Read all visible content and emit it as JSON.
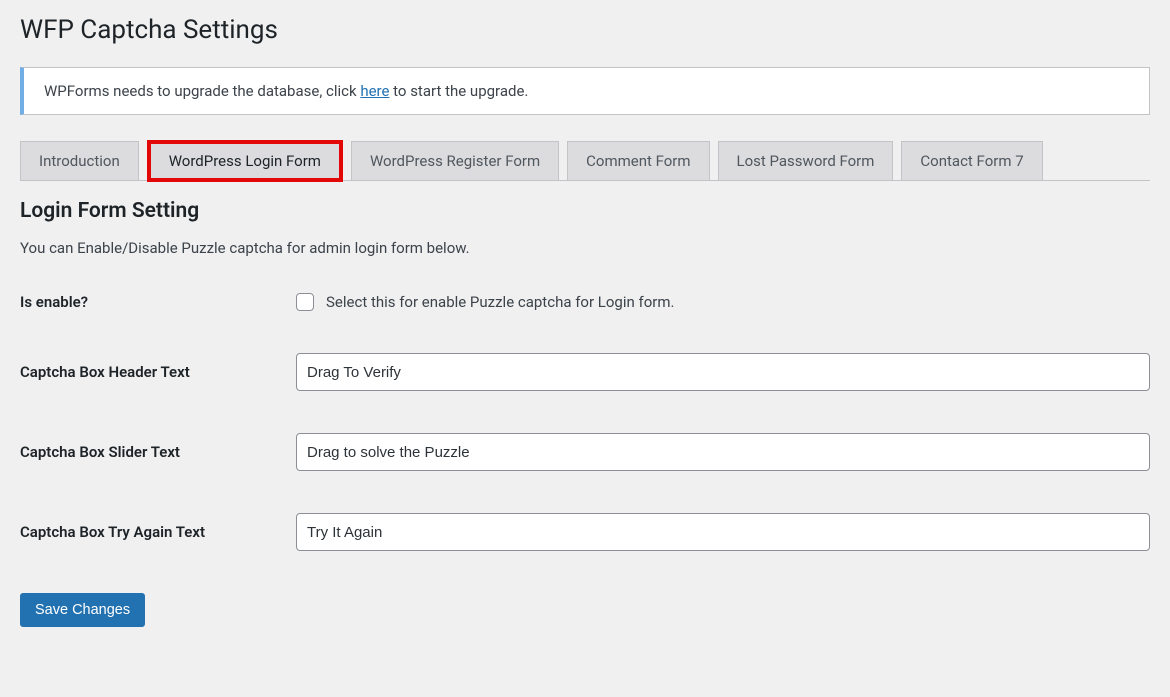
{
  "page": {
    "title": "WFP Captcha Settings"
  },
  "notice": {
    "text_before": "WPForms needs to upgrade the database, click ",
    "link_text": "here",
    "text_after": " to start the upgrade."
  },
  "tabs": [
    {
      "label": "Introduction",
      "active": false
    },
    {
      "label": "WordPress Login Form",
      "active": true
    },
    {
      "label": "WordPress Register Form",
      "active": false
    },
    {
      "label": "Comment Form",
      "active": false
    },
    {
      "label": "Lost Password Form",
      "active": false
    },
    {
      "label": "Contact Form 7",
      "active": false
    }
  ],
  "section": {
    "title": "Login Form Setting",
    "description": "You can Enable/Disable Puzzle captcha for admin login form below."
  },
  "form": {
    "is_enable": {
      "label": "Is enable?",
      "checkbox_text": "Select this for enable Puzzle captcha for Login form.",
      "checked": false
    },
    "header_text": {
      "label": "Captcha Box Header Text",
      "value": "Drag To Verify"
    },
    "slider_text": {
      "label": "Captcha Box Slider Text",
      "value": "Drag to solve the Puzzle"
    },
    "try_again_text": {
      "label": "Captcha Box Try Again Text",
      "value": "Try It Again"
    }
  },
  "buttons": {
    "save": "Save Changes"
  }
}
